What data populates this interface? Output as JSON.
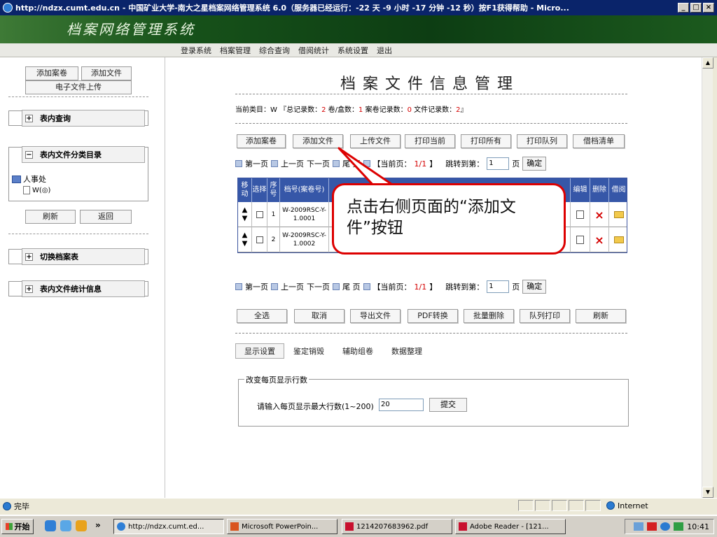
{
  "window": {
    "title": "http://ndzx.cumt.edu.cn - 中国矿业大学-南大之星档案网络管理系统 6.0（服务器已经运行：-22 天 -9 小时 -17 分钟 -12 秒）按F1获得帮助 - Micro..."
  },
  "banner": {
    "title": "档案网络管理系统"
  },
  "nav": [
    "登录系统",
    "档案管理",
    "综合查询",
    "借阅统计",
    "系统设置",
    "退出"
  ],
  "left": {
    "add_volume": "添加案卷",
    "add_file": "添加文件",
    "upload_efile": "电子文件上传",
    "query_group": "表内查询",
    "catalog_group": "表内文件分类目录",
    "tree_root": "人事处",
    "tree_child": "W(◎)",
    "refresh": "刷新",
    "back": "返回",
    "switch_group": "切换档案表",
    "stats_group": "表内文件统计信息"
  },
  "main": {
    "title": "档案文件信息管理",
    "info": {
      "category_label": "当前类目：W 『总记录数：",
      "total": "2",
      "box_label": " 卷/盒数：",
      "boxes": "1",
      "volume_label": " 案卷记录数：",
      "volumes": "0",
      "file_label": " 文件记录数：",
      "files": "2",
      "end": "』"
    },
    "toolbar": [
      "添加案卷",
      "添加文件",
      "上传文件",
      "打印当前",
      "打印所有",
      "打印队列",
      "借档清单"
    ],
    "pager": {
      "first": "第一页",
      "prev": "上一页",
      "next": "下一页",
      "last": "尾 页",
      "current_label": "【当前页：",
      "current": "1/1",
      "current_end": "】",
      "jump_label": "跳转到第：",
      "jump_value": "1",
      "page_unit": "页",
      "confirm": "确定"
    },
    "table": {
      "headers": [
        "移动",
        "选择",
        "序号",
        "档号(案卷号)",
        "编辑",
        "删除",
        "借阅"
      ],
      "rows": [
        {
          "seq": "1",
          "code": "W-2009RSC-Y-1.0001"
        },
        {
          "seq": "2",
          "code": "W-2009RSC-Y-1.0002"
        }
      ]
    },
    "bottom_buttons": [
      "全选",
      "取消",
      "导出文件",
      "PDF转换",
      "批量删除",
      "队列打印",
      "刷新"
    ],
    "subtabs": [
      "显示设置",
      "鉴定销毁",
      "辅助组卷",
      "数据整理"
    ],
    "rows_setting": {
      "legend": "改变每页显示行数",
      "label": "请输入每页显示最大行数(1~200)",
      "value": "20",
      "submit": "提交"
    },
    "callout": "点击右侧页面的“添加文件”按钮"
  },
  "statusbar": {
    "status": "完毕",
    "zone": "Internet"
  },
  "taskbar": {
    "start": "开始",
    "more": "»",
    "tasks": [
      "http://ndzx.cumt.ed...",
      "Microsoft PowerPoin...",
      "1214207683962.pdf",
      "Adobe Reader - [121..."
    ],
    "clock": "10:41"
  }
}
